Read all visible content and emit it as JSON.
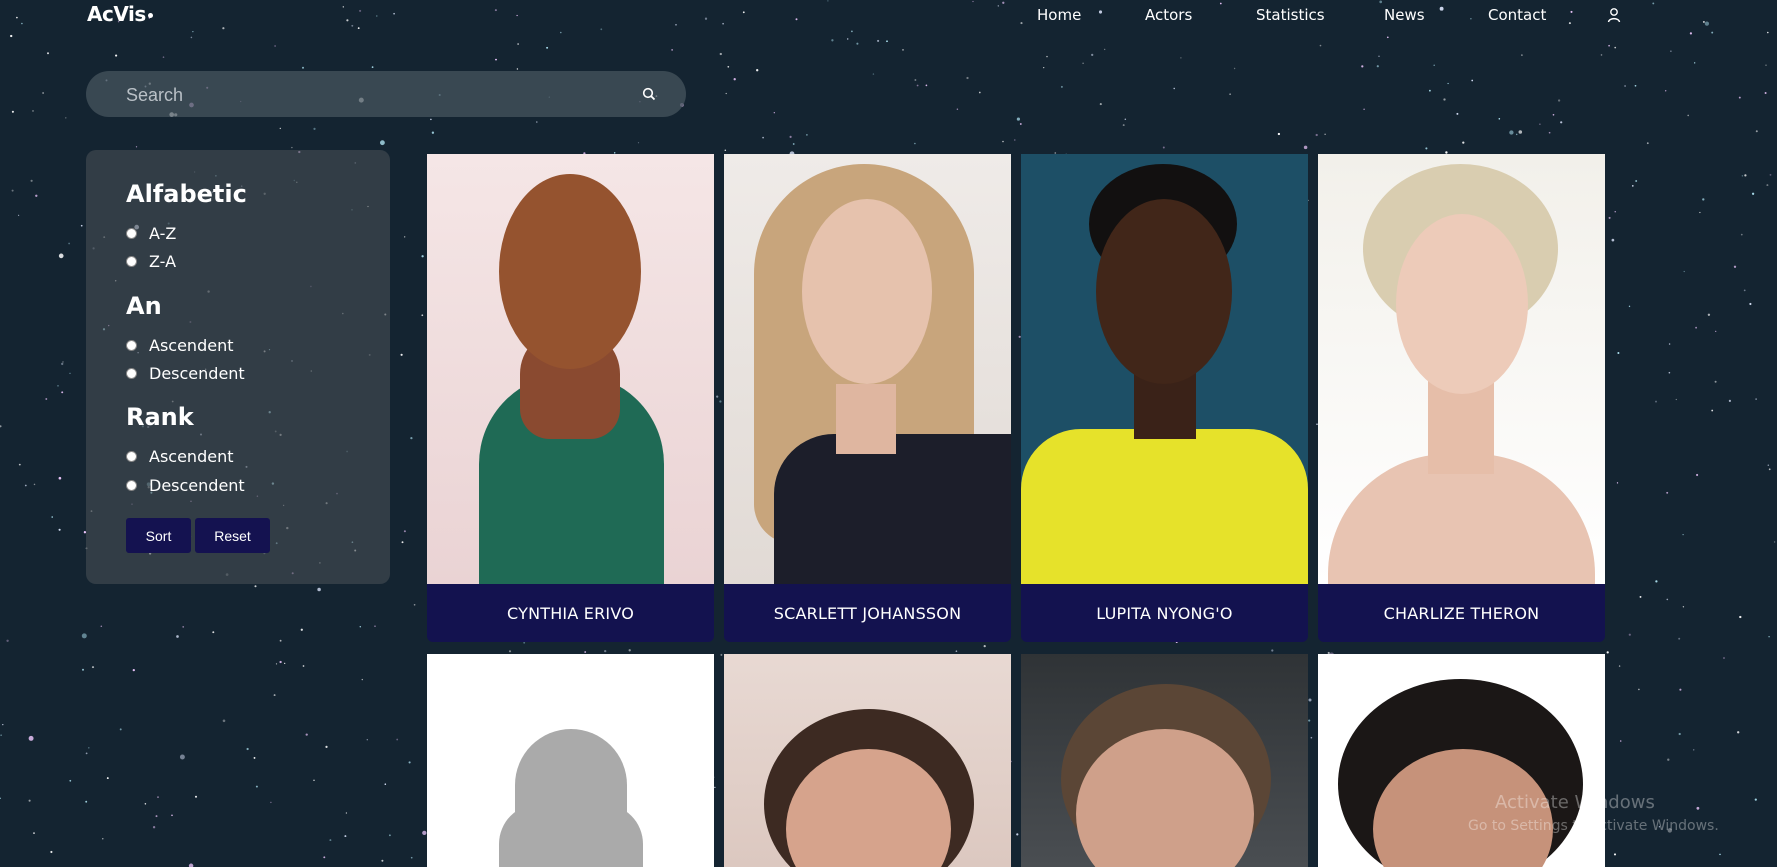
{
  "nav": {
    "logo": "AcVis",
    "links": [
      "Home",
      "Actors",
      "Statistics",
      "News",
      "Contact"
    ],
    "user_icon": "user-icon"
  },
  "search": {
    "placeholder": "Search",
    "icon": "search-icon"
  },
  "filters": {
    "groups": [
      {
        "title": "Alfabetic",
        "options": [
          "A-Z",
          "Z-A"
        ]
      },
      {
        "title": "An",
        "options": [
          "Ascendent",
          "Descendent"
        ]
      },
      {
        "title": "Rank",
        "options": [
          "Ascendent",
          "Descendent"
        ]
      }
    ],
    "sort_label": "Sort",
    "reset_label": "Reset"
  },
  "actors": [
    {
      "name": "CYNTHIA ERIVO"
    },
    {
      "name": "SCARLETT JOHANSSON"
    },
    {
      "name": "LUPITA NYONG'O"
    },
    {
      "name": "CHARLIZE THERON"
    },
    {
      "name": ""
    },
    {
      "name": ""
    },
    {
      "name": ""
    },
    {
      "name": ""
    }
  ],
  "watermark": {
    "line1": "Activate Windows",
    "line2": "Go to Settings to activate Windows."
  },
  "colors": {
    "background": "#142431",
    "card_caption": "#13124f",
    "button": "#141250"
  }
}
